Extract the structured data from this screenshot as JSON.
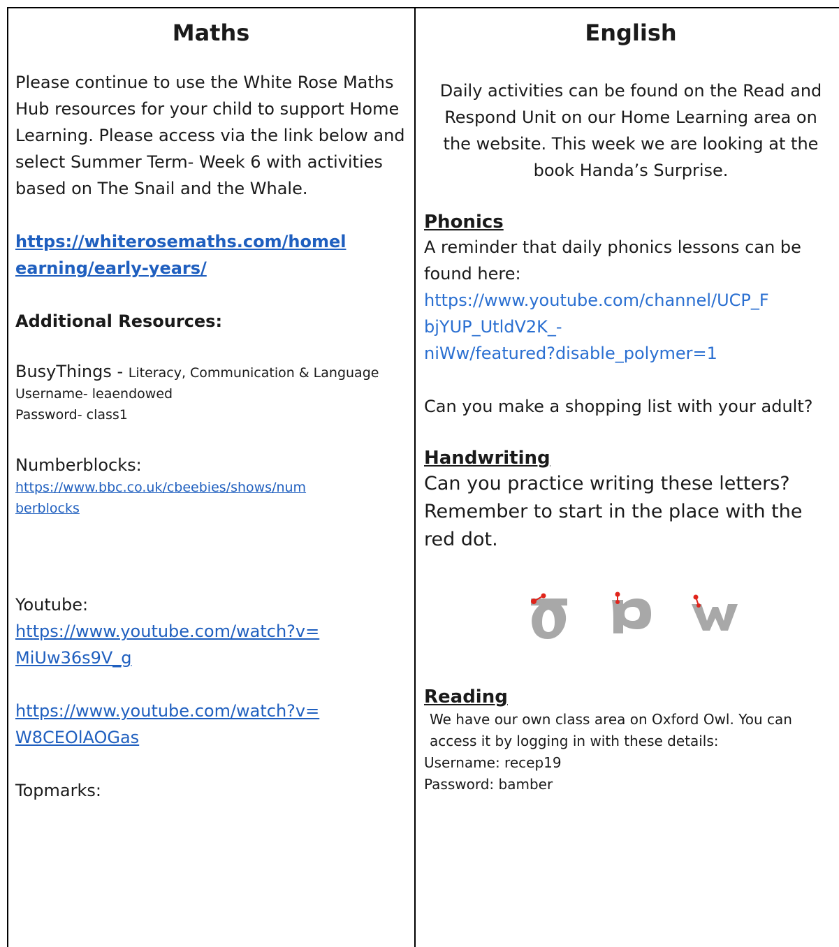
{
  "maths": {
    "title": "Maths",
    "intro": "Please continue to use the White Rose Maths Hub resources for your child to support Home Learning. Please access via the link below and select Summer Term- Week 6 with activities based on The Snail and the Whale.",
    "white_rose_link_line1": "https://whiterosemaths.com/homel",
    "white_rose_link_line2": "earning/early-years/",
    "additional_heading": "Additional Resources:",
    "busythings_name": "BusyThings - ",
    "busythings_desc": "Literacy, Communication & Language",
    "busythings_username": "Username- leaendowed",
    "busythings_password": "Password- class1",
    "numberblocks_label": "Numberblocks:",
    "numberblocks_link_line1": "https://www.bbc.co.uk/cbeebies/shows/num",
    "numberblocks_link_line2": "berblocks",
    "youtube_label": "Youtube:",
    "youtube_link1_line1": "https://www.youtube.com/watch?v=",
    "youtube_link1_line2": "MiUw36s9V_g",
    "youtube_link2_line1": "https://www.youtube.com/watch?v=",
    "youtube_link2_line2": "W8CEOlAOGas",
    "topmarks_label": "Topmarks:"
  },
  "english": {
    "title": "English",
    "intro": "Daily activities can be found on the Read and Respond Unit on our Home Learning area on the website. This week we are looking at the book Handa’s Surprise.",
    "phonics_heading": "Phonics",
    "phonics_text": "A reminder that daily phonics lessons can be found here:",
    "phonics_link_line1": "https://www.youtube.com/channel/UCP_F",
    "phonics_link_line2": "bjYUP_UtldV2K_-",
    "phonics_link_line3": "niWw/featured?disable_polymer=1",
    "shopping_text": "Can you make a shopping list with your adult?",
    "handwriting_heading": "Handwriting",
    "handwriting_text": "Can you practice writing these letters? Remember to start in the place with the red dot.",
    "reading_heading": "Reading",
    "reading_text": "We have our own class area on Oxford Owl. You can access it by logging in with these details:",
    "reading_username": "Username: recep19",
    "reading_password": "Password: bamber"
  },
  "colors": {
    "link": "#1f5fbf",
    "letter_grey": "#a8a8a8",
    "start_dot": "#e0241b"
  }
}
